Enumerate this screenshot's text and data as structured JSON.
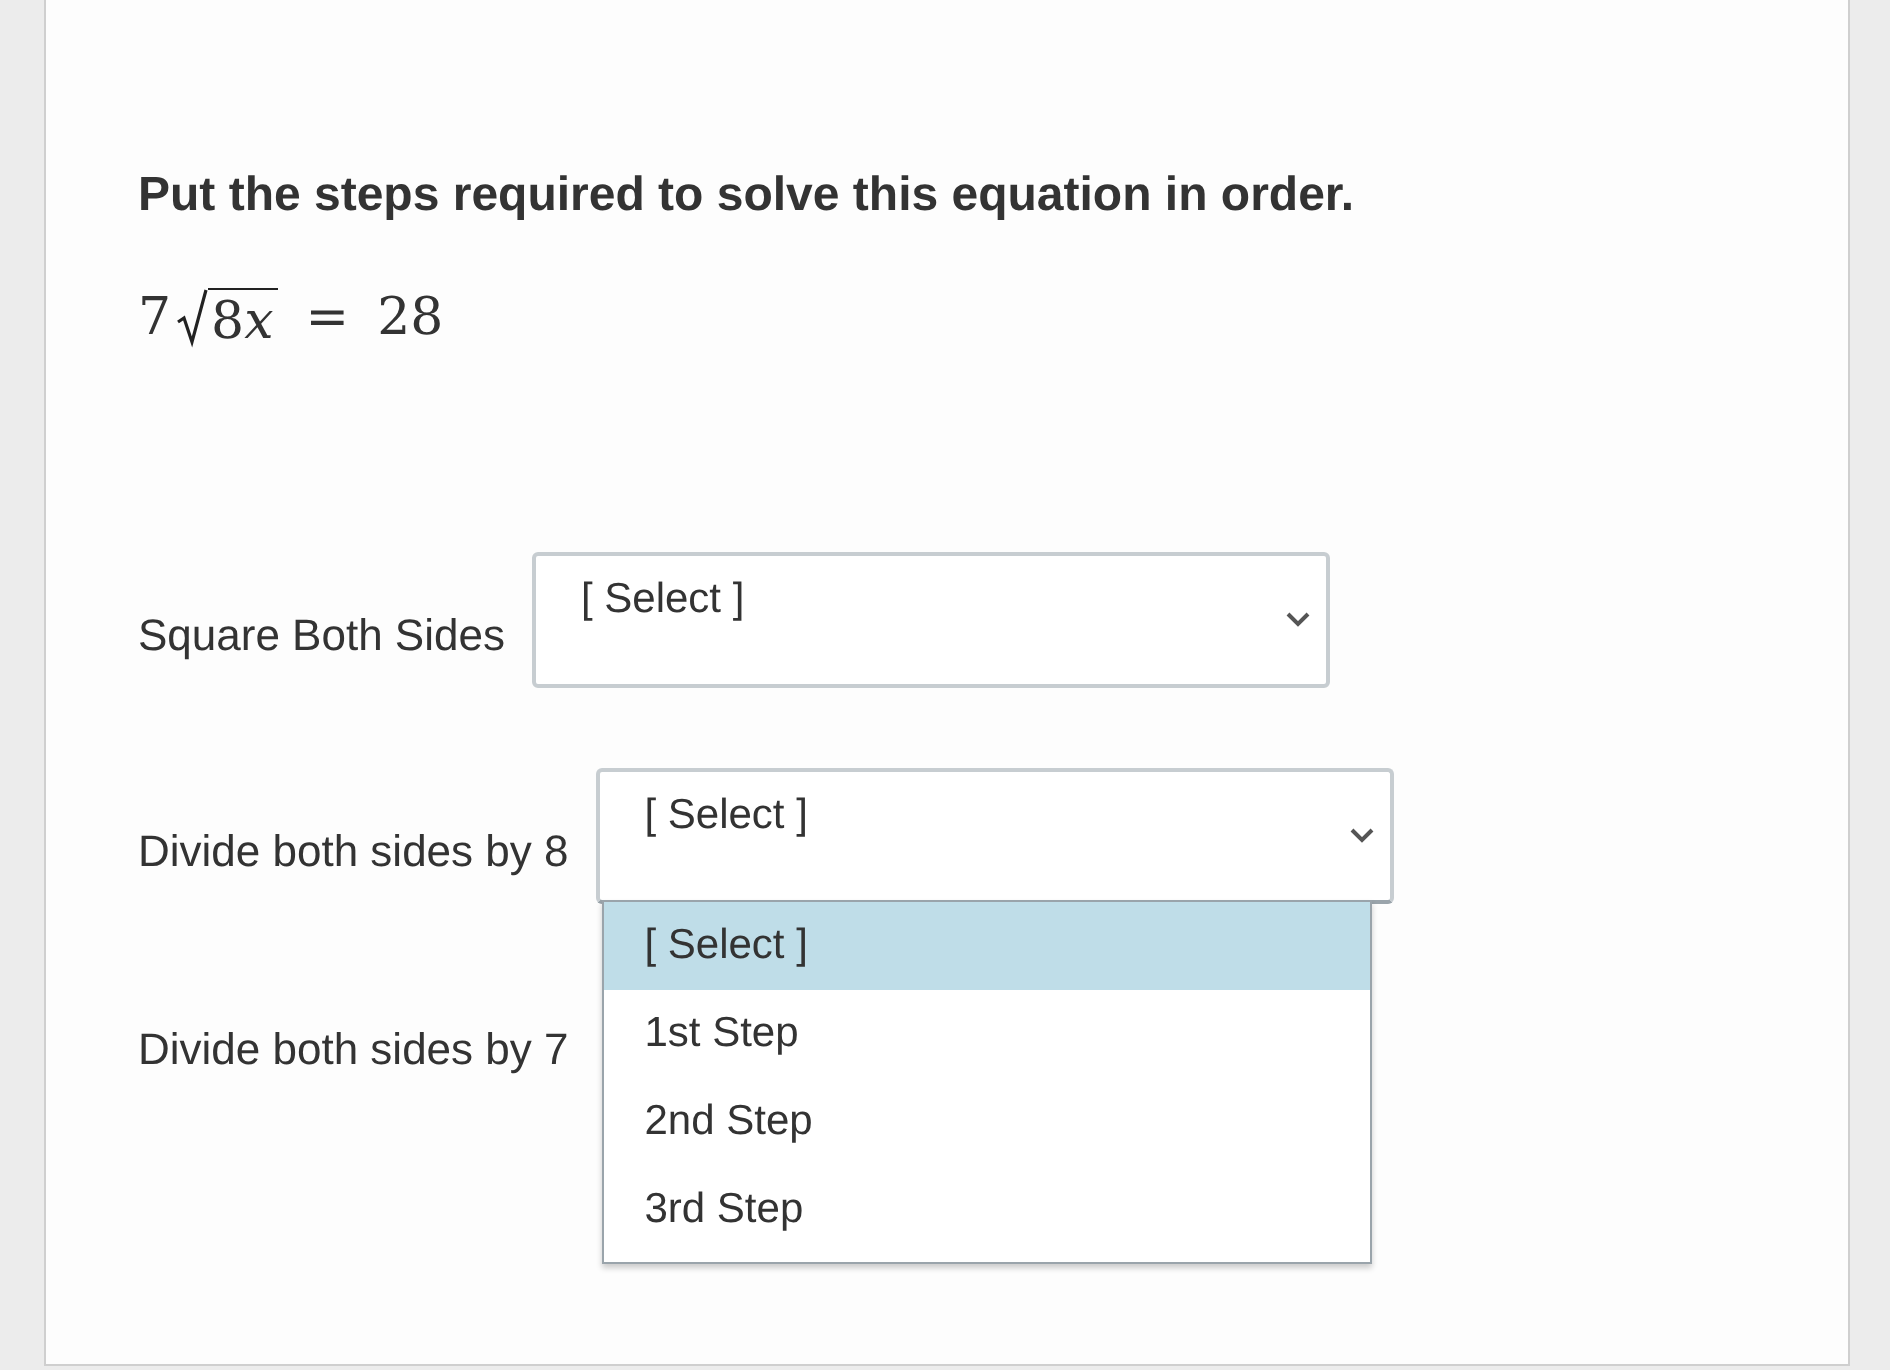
{
  "question": {
    "prompt": "Put the steps required to solve this equation in order.",
    "equation": {
      "coefficient": "7",
      "radicand_number": "8",
      "radicand_variable": "x",
      "relation": "=",
      "rhs": "28"
    }
  },
  "rows": [
    {
      "label": "Square Both Sides",
      "select": {
        "value": "[ Select ]",
        "open": false
      }
    },
    {
      "label": "Divide both sides by 8",
      "select": {
        "value": "[ Select ]",
        "open": true,
        "options": [
          {
            "label": "[ Select ]",
            "selected": true
          },
          {
            "label": "1st Step",
            "selected": false
          },
          {
            "label": "2nd Step",
            "selected": false
          },
          {
            "label": "3rd Step",
            "selected": false
          }
        ]
      }
    },
    {
      "label": "Divide both sides by 7"
    }
  ]
}
